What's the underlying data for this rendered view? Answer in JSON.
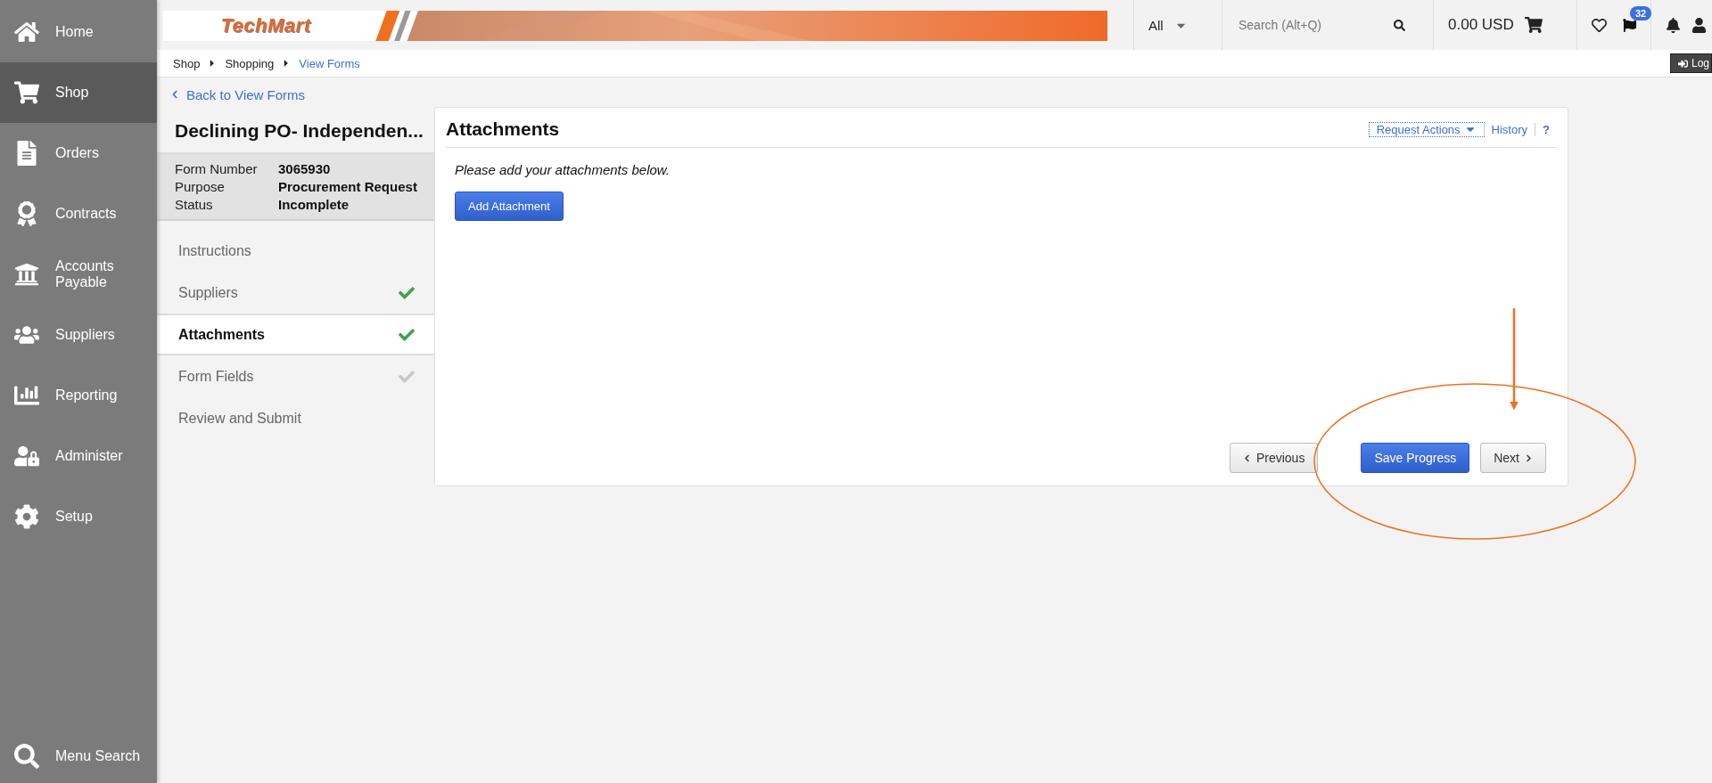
{
  "nav": [
    {
      "label": "Home",
      "selected": false
    },
    {
      "label": "Shop",
      "selected": true
    },
    {
      "label": "Orders",
      "selected": false
    },
    {
      "label": "Contracts",
      "selected": false
    },
    {
      "label": "Accounts Payable",
      "selected": false
    },
    {
      "label": "Suppliers",
      "selected": false
    },
    {
      "label": "Reporting",
      "selected": false
    },
    {
      "label": "Administer",
      "selected": false
    },
    {
      "label": "Setup",
      "selected": false
    }
  ],
  "menu_search": {
    "label": "Menu Search"
  },
  "header": {
    "logo": "TechMart",
    "scope": "All",
    "search": {
      "placeholder": "Search (Alt+Q)"
    },
    "cart_total": "0.00 USD",
    "flag_count": "32",
    "logout": "Log"
  },
  "breadcrumb": [
    {
      "label": "Shop",
      "current": false
    },
    {
      "label": "Shopping",
      "current": false
    },
    {
      "label": "View Forms",
      "current": true
    }
  ],
  "back_link": "Back to View Forms",
  "form": {
    "title": "Declining PO- Independen...",
    "info": [
      {
        "label": "Form Number",
        "value": "3065930"
      },
      {
        "label": "Purpose",
        "value": "Procurement Request"
      },
      {
        "label": "Status",
        "value": "Incomplete"
      }
    ],
    "steps": [
      {
        "label": "Instructions",
        "selected": false
      },
      {
        "label": "Suppliers",
        "selected": false,
        "checked": true
      },
      {
        "label": "Attachments",
        "selected": true,
        "checked": true
      },
      {
        "label": "Form Fields",
        "selected": false,
        "checked": false
      },
      {
        "label": "Review and Submit",
        "selected": false
      }
    ]
  },
  "panel": {
    "title": "Attachments",
    "actions": [
      "Request Actions",
      "History",
      "?"
    ],
    "instruction": "Please add your attachments below.",
    "add_button": "Add Attachment",
    "buttons": [
      {
        "label": "Previous",
        "kind": "prev"
      },
      {
        "label": "Save Progress",
        "kind": "primary"
      },
      {
        "label": "Next",
        "kind": "next"
      }
    ]
  }
}
